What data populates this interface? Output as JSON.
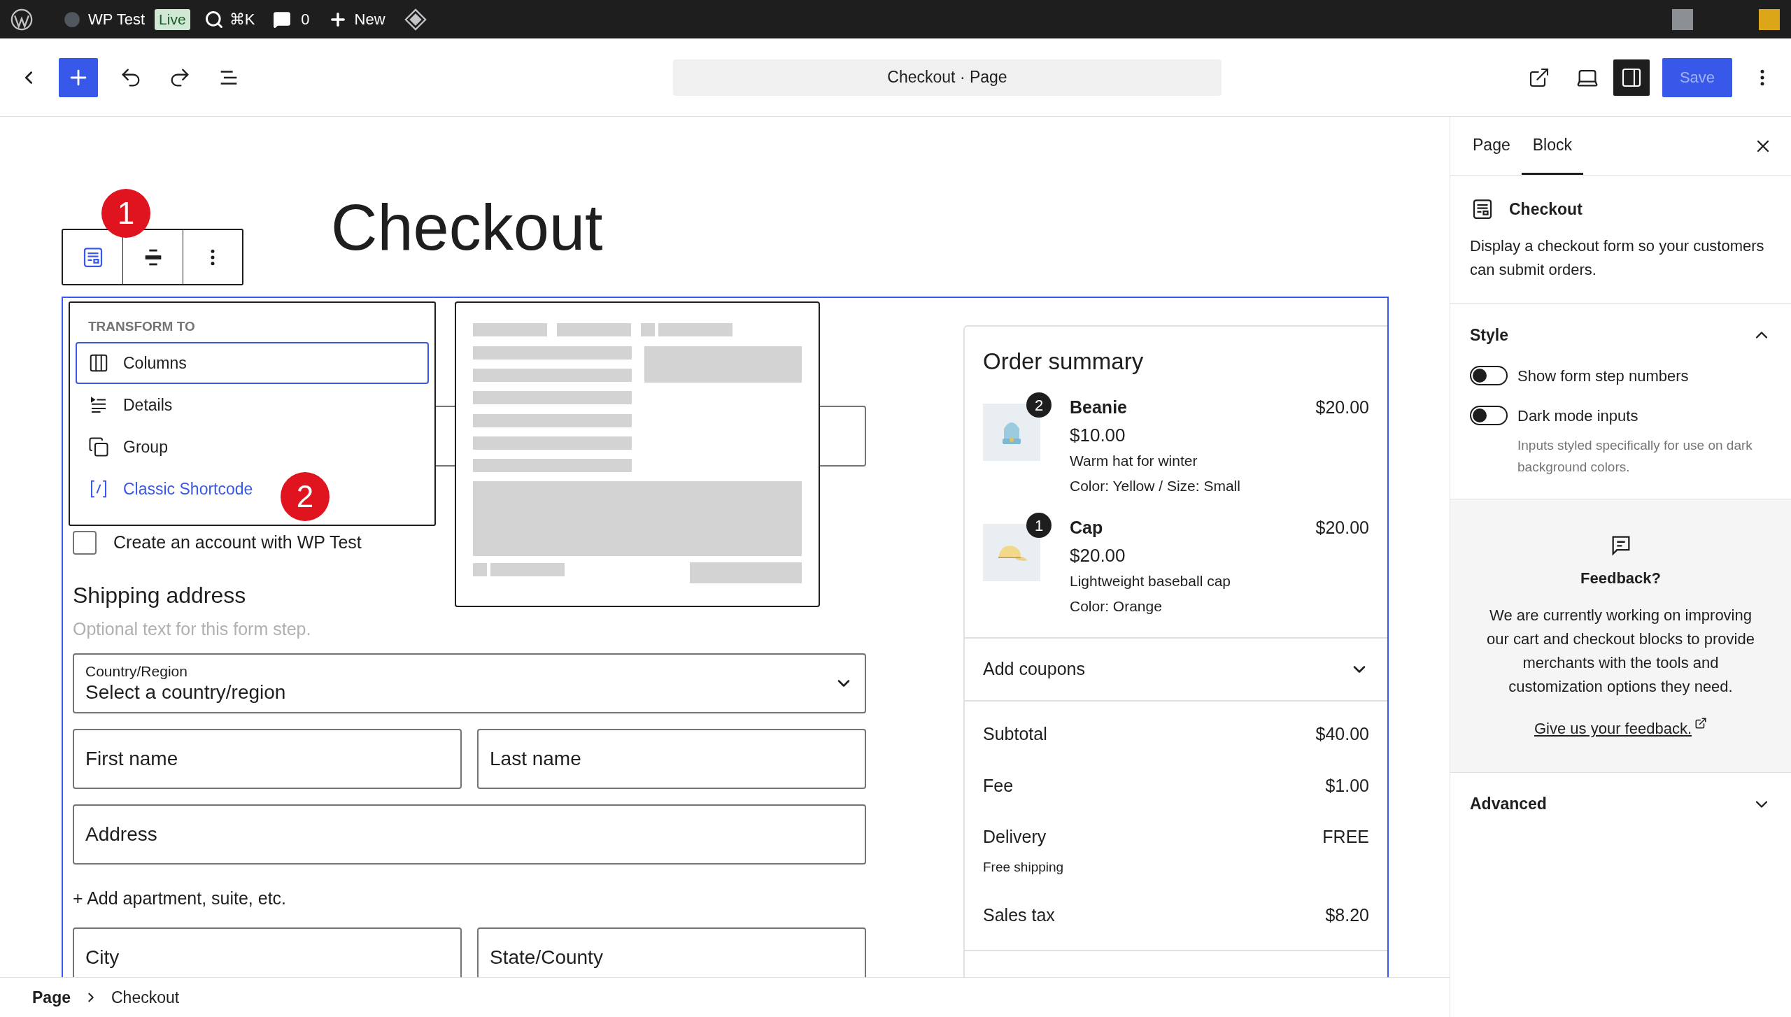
{
  "admin_bar": {
    "site": "WP Test",
    "status": "Live",
    "shortcut": "⌘K",
    "comments": "0",
    "new": "New"
  },
  "editor_toolbar": {
    "document": "Checkout · Page",
    "sidebar_toggle": {
      "on": true
    },
    "save": {
      "label": "Save",
      "disabled": true
    }
  },
  "block_toolbar": {
    "annotation": "1"
  },
  "page_title": "Checkout",
  "transform_menu": {
    "heading": "TRANSFORM TO",
    "annotation": "2",
    "items": [
      {
        "label": "Columns",
        "kind": "columns",
        "selected": true,
        "highlighted": false
      },
      {
        "label": "Details",
        "kind": "details",
        "selected": false,
        "highlighted": false
      },
      {
        "label": "Group",
        "kind": "group",
        "selected": false,
        "highlighted": false
      },
      {
        "label": "Classic Shortcode",
        "kind": "shortcode",
        "selected": false,
        "highlighted": true
      }
    ]
  },
  "checkout_form": {
    "account_checkbox": {
      "label": "Create an account with WP Test",
      "checked": false
    },
    "shipping": {
      "heading": "Shipping address",
      "description": "Optional text for this form step.",
      "country": {
        "label": "Country/Region",
        "value": "Select a country/region"
      },
      "rows": [
        {
          "fields": [
            {
              "placeholder": "First name"
            },
            {
              "placeholder": "Last name"
            }
          ]
        },
        {
          "fields": [
            {
              "placeholder": "Address"
            }
          ]
        },
        {
          "link": "+ Add apartment, suite, etc."
        },
        {
          "fields": [
            {
              "placeholder": "City"
            },
            {
              "placeholder": "State/County"
            }
          ]
        }
      ]
    }
  },
  "order_summary": {
    "title": "Order summary",
    "items": [
      {
        "name": "Beanie",
        "quantity": "2",
        "total": "$20.00",
        "price": "$10.00",
        "description": "Warm hat for winter",
        "variation": "Color: Yellow / Size: Small"
      },
      {
        "name": "Cap",
        "quantity": "1",
        "total": "$20.00",
        "price": "$20.00",
        "description": "Lightweight baseball cap",
        "variation": "Color: Orange"
      }
    ],
    "coupons": {
      "label": "Add coupons",
      "expanded": false
    },
    "totals": [
      {
        "label": "Subtotal",
        "value": "$40.00"
      },
      {
        "label": "Fee",
        "value": "$1.00"
      },
      {
        "label": "Delivery",
        "value": "FREE",
        "note": "Free shipping"
      },
      {
        "label": "Sales tax",
        "value": "$8.20"
      }
    ]
  },
  "sidebar": {
    "tabs": [
      {
        "label": "Page",
        "selected": false
      },
      {
        "label": "Block",
        "selected": true
      }
    ],
    "block": {
      "title": "Checkout",
      "description": "Display a checkout form so your customers can submit orders."
    },
    "style": {
      "title": "Style",
      "expanded": true,
      "toggles": [
        {
          "label": "Show form step numbers",
          "on": false
        },
        {
          "label": "Dark mode inputs",
          "on": false,
          "help": "Inputs styled specifically for use on dark background colors."
        }
      ]
    },
    "feedback": {
      "title": "Feedback?",
      "text": "We are currently working on improving our cart and checkout blocks to provide merchants with the tools and customization options they need.",
      "link": "Give us your feedback."
    },
    "advanced": {
      "title": "Advanced",
      "expanded": false
    }
  },
  "breadcrumb": [
    {
      "label": "Page"
    },
    {
      "label": "Checkout"
    }
  ]
}
